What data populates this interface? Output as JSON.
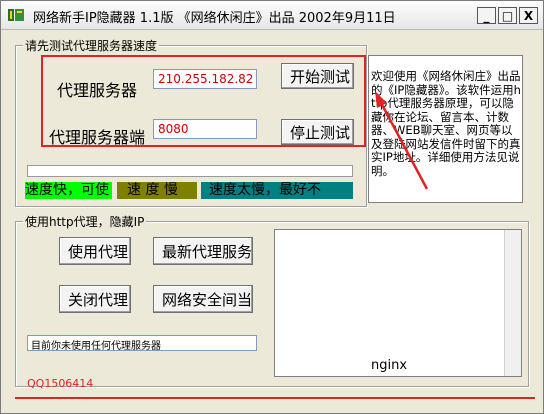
{
  "window": {
    "title": "网络新手IP隐藏器 1.1版 《网络休闲庄》出品 2002年9月11日",
    "minimize_label": "_",
    "maximize_label": "□",
    "close_label": "X"
  },
  "test_group": {
    "title": "请先测试代理服务器速度",
    "server_label": "代理服务器",
    "server_value": "210.255.182.82",
    "port_label": "代理服务器端",
    "port_value": "8080",
    "start_test_label": "开始测试",
    "stop_test_label": "停止测试"
  },
  "info": {
    "text": "欢迎使用《网络休闲庄》出品的《IP隐藏器》。该软件运用http代理服务器原理，可以隐藏你在论坛、留言本、计数器、WEB聊天室、网页等以及登陆网站发信件时留下的真实IP地址。详细使用方法见说明。"
  },
  "speed_legend": {
    "fast": "速度快，可使",
    "slow": "速 度 慢",
    "too_slow": "速度太慢，最好不"
  },
  "proxy_group": {
    "title": "使用http代理，隐藏IP",
    "use_proxy_label": "使用代理",
    "latest_proxy_label": "最新代理服务",
    "close_proxy_label": "关闭代理",
    "net_security_label": "网络安全间当",
    "status_text": "目前你未使用任何代理服务器"
  },
  "right_list": {
    "content": "nginx"
  },
  "footer": {
    "qq": "QQ1506414"
  },
  "colors": {
    "fast": "#00ff00",
    "slow": "#808000",
    "too_slow": "#008080",
    "highlight": "#e02424"
  }
}
